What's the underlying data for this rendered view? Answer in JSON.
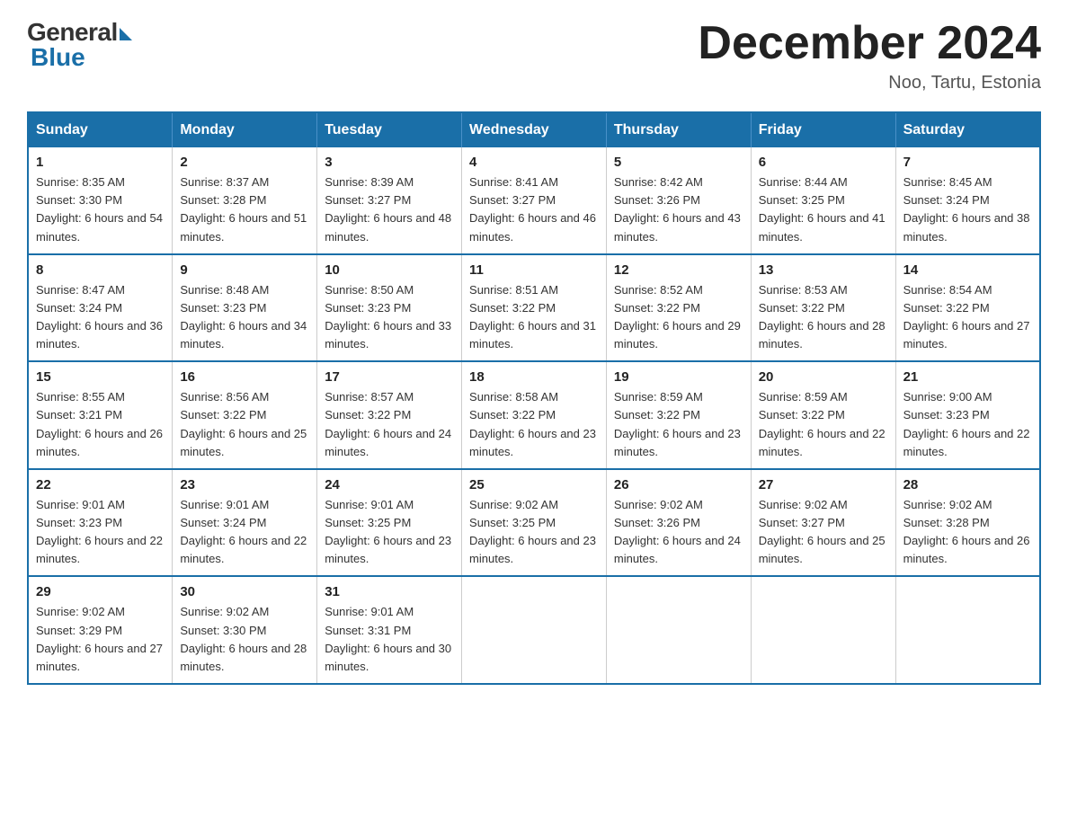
{
  "header": {
    "logo_general": "General",
    "logo_blue": "Blue",
    "month_title": "December 2024",
    "location": "Noo, Tartu, Estonia"
  },
  "weekdays": [
    "Sunday",
    "Monday",
    "Tuesday",
    "Wednesday",
    "Thursday",
    "Friday",
    "Saturday"
  ],
  "weeks": [
    [
      {
        "day": "1",
        "sunrise": "8:35 AM",
        "sunset": "3:30 PM",
        "daylight": "6 hours and 54 minutes."
      },
      {
        "day": "2",
        "sunrise": "8:37 AM",
        "sunset": "3:28 PM",
        "daylight": "6 hours and 51 minutes."
      },
      {
        "day": "3",
        "sunrise": "8:39 AM",
        "sunset": "3:27 PM",
        "daylight": "6 hours and 48 minutes."
      },
      {
        "day": "4",
        "sunrise": "8:41 AM",
        "sunset": "3:27 PM",
        "daylight": "6 hours and 46 minutes."
      },
      {
        "day": "5",
        "sunrise": "8:42 AM",
        "sunset": "3:26 PM",
        "daylight": "6 hours and 43 minutes."
      },
      {
        "day": "6",
        "sunrise": "8:44 AM",
        "sunset": "3:25 PM",
        "daylight": "6 hours and 41 minutes."
      },
      {
        "day": "7",
        "sunrise": "8:45 AM",
        "sunset": "3:24 PM",
        "daylight": "6 hours and 38 minutes."
      }
    ],
    [
      {
        "day": "8",
        "sunrise": "8:47 AM",
        "sunset": "3:24 PM",
        "daylight": "6 hours and 36 minutes."
      },
      {
        "day": "9",
        "sunrise": "8:48 AM",
        "sunset": "3:23 PM",
        "daylight": "6 hours and 34 minutes."
      },
      {
        "day": "10",
        "sunrise": "8:50 AM",
        "sunset": "3:23 PM",
        "daylight": "6 hours and 33 minutes."
      },
      {
        "day": "11",
        "sunrise": "8:51 AM",
        "sunset": "3:22 PM",
        "daylight": "6 hours and 31 minutes."
      },
      {
        "day": "12",
        "sunrise": "8:52 AM",
        "sunset": "3:22 PM",
        "daylight": "6 hours and 29 minutes."
      },
      {
        "day": "13",
        "sunrise": "8:53 AM",
        "sunset": "3:22 PM",
        "daylight": "6 hours and 28 minutes."
      },
      {
        "day": "14",
        "sunrise": "8:54 AM",
        "sunset": "3:22 PM",
        "daylight": "6 hours and 27 minutes."
      }
    ],
    [
      {
        "day": "15",
        "sunrise": "8:55 AM",
        "sunset": "3:21 PM",
        "daylight": "6 hours and 26 minutes."
      },
      {
        "day": "16",
        "sunrise": "8:56 AM",
        "sunset": "3:22 PM",
        "daylight": "6 hours and 25 minutes."
      },
      {
        "day": "17",
        "sunrise": "8:57 AM",
        "sunset": "3:22 PM",
        "daylight": "6 hours and 24 minutes."
      },
      {
        "day": "18",
        "sunrise": "8:58 AM",
        "sunset": "3:22 PM",
        "daylight": "6 hours and 23 minutes."
      },
      {
        "day": "19",
        "sunrise": "8:59 AM",
        "sunset": "3:22 PM",
        "daylight": "6 hours and 23 minutes."
      },
      {
        "day": "20",
        "sunrise": "8:59 AM",
        "sunset": "3:22 PM",
        "daylight": "6 hours and 22 minutes."
      },
      {
        "day": "21",
        "sunrise": "9:00 AM",
        "sunset": "3:23 PM",
        "daylight": "6 hours and 22 minutes."
      }
    ],
    [
      {
        "day": "22",
        "sunrise": "9:01 AM",
        "sunset": "3:23 PM",
        "daylight": "6 hours and 22 minutes."
      },
      {
        "day": "23",
        "sunrise": "9:01 AM",
        "sunset": "3:24 PM",
        "daylight": "6 hours and 22 minutes."
      },
      {
        "day": "24",
        "sunrise": "9:01 AM",
        "sunset": "3:25 PM",
        "daylight": "6 hours and 23 minutes."
      },
      {
        "day": "25",
        "sunrise": "9:02 AM",
        "sunset": "3:25 PM",
        "daylight": "6 hours and 23 minutes."
      },
      {
        "day": "26",
        "sunrise": "9:02 AM",
        "sunset": "3:26 PM",
        "daylight": "6 hours and 24 minutes."
      },
      {
        "day": "27",
        "sunrise": "9:02 AM",
        "sunset": "3:27 PM",
        "daylight": "6 hours and 25 minutes."
      },
      {
        "day": "28",
        "sunrise": "9:02 AM",
        "sunset": "3:28 PM",
        "daylight": "6 hours and 26 minutes."
      }
    ],
    [
      {
        "day": "29",
        "sunrise": "9:02 AM",
        "sunset": "3:29 PM",
        "daylight": "6 hours and 27 minutes."
      },
      {
        "day": "30",
        "sunrise": "9:02 AM",
        "sunset": "3:30 PM",
        "daylight": "6 hours and 28 minutes."
      },
      {
        "day": "31",
        "sunrise": "9:01 AM",
        "sunset": "3:31 PM",
        "daylight": "6 hours and 30 minutes."
      },
      null,
      null,
      null,
      null
    ]
  ]
}
